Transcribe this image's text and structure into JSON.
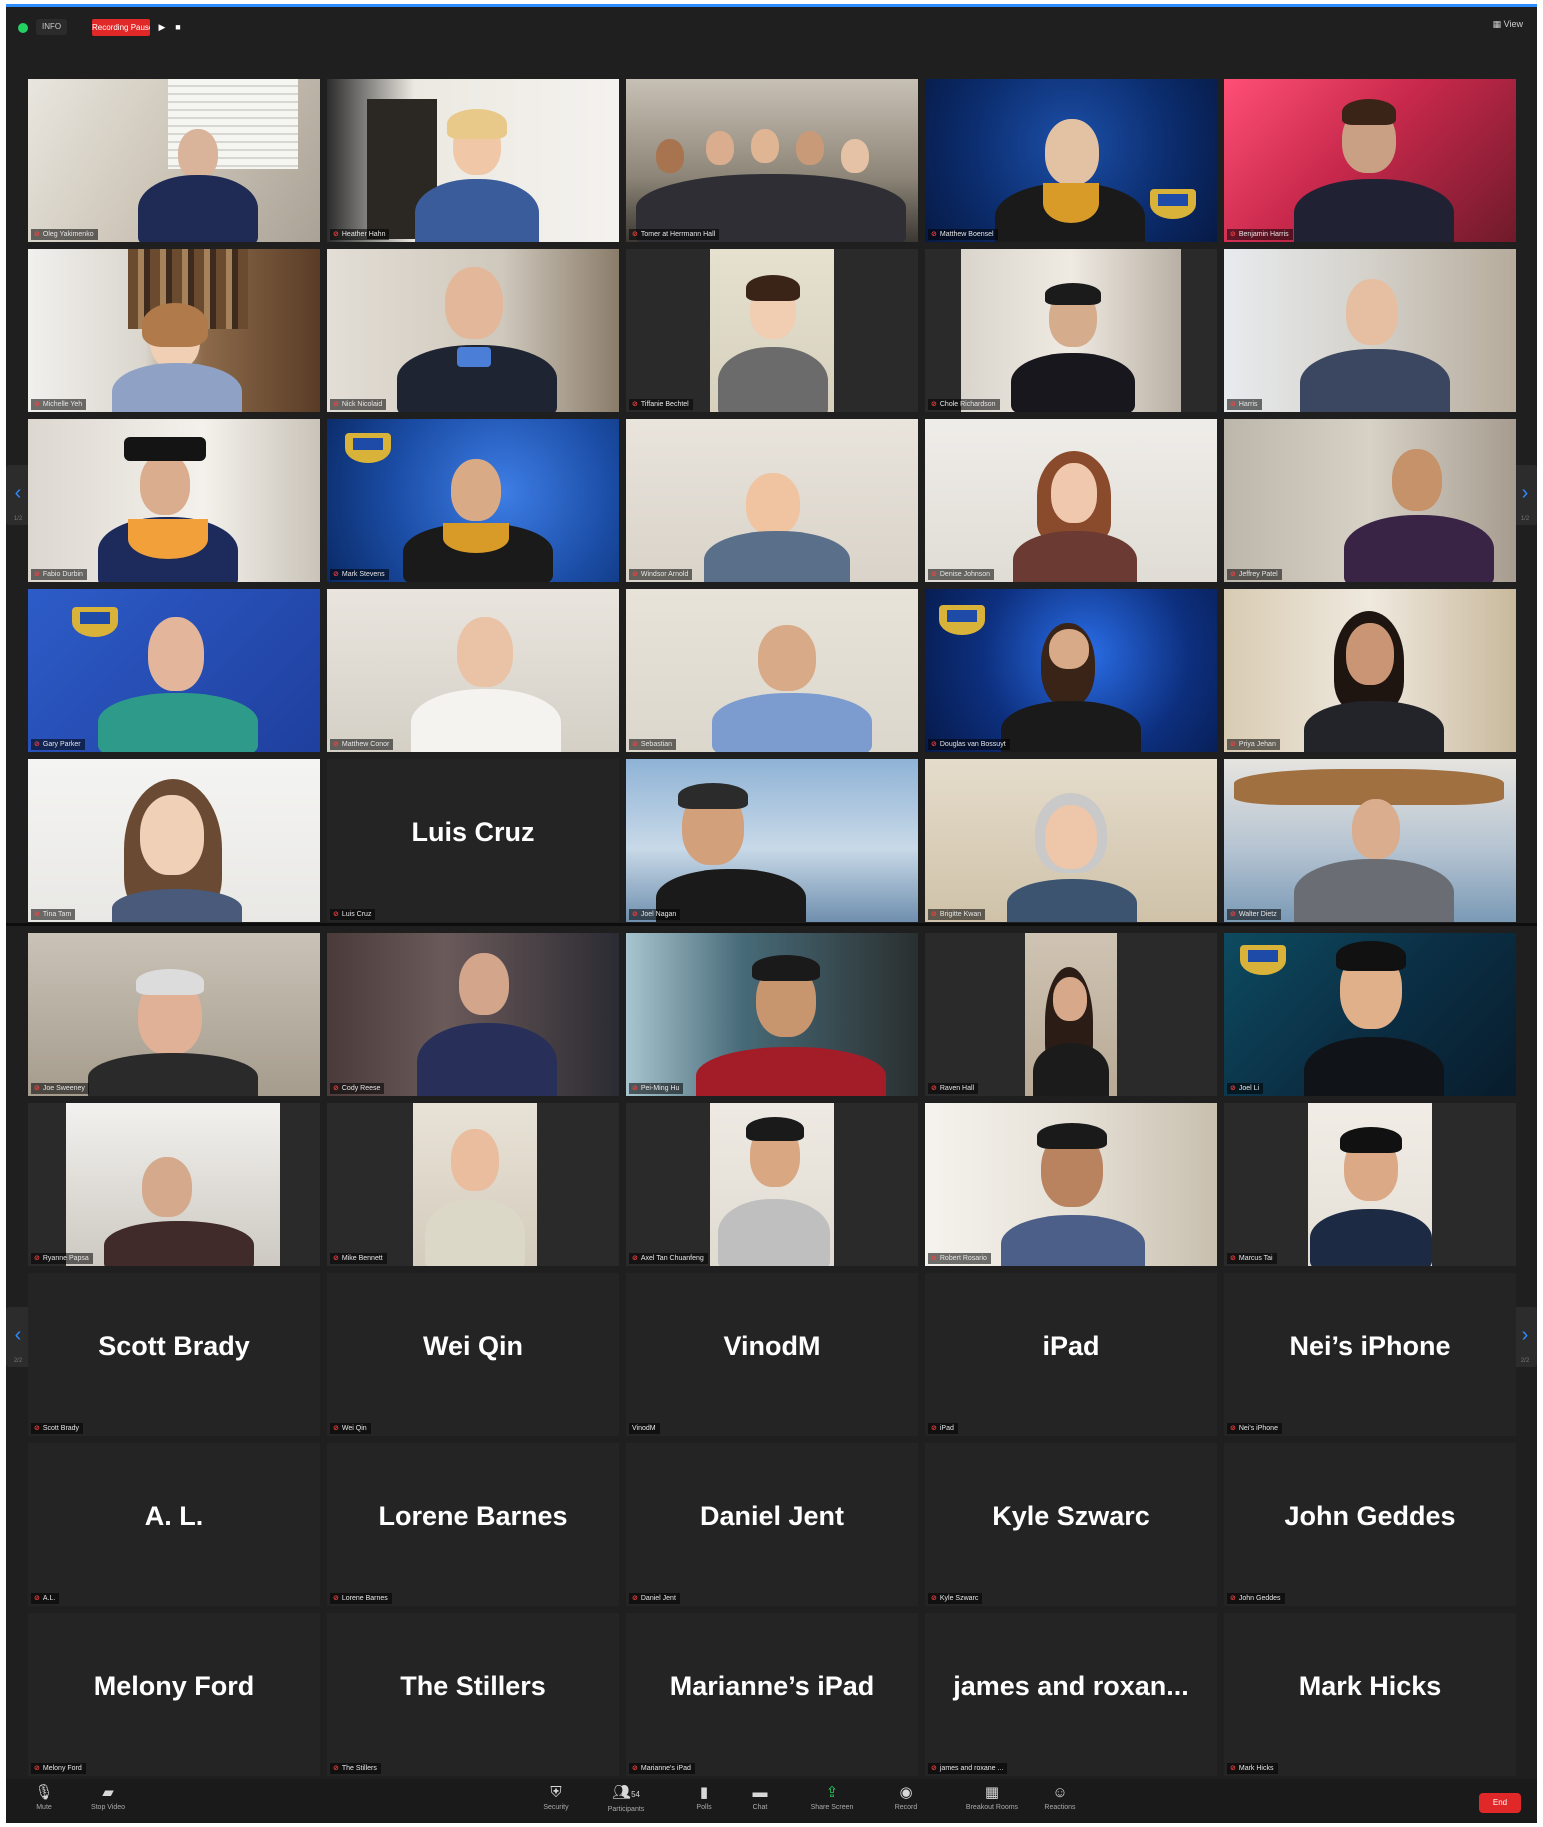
{
  "topbar": {
    "info_label": "INFO",
    "recording_status": "Recording Paused",
    "resume_icon": "play-icon",
    "stop_icon": "stop-icon",
    "view_label": "View"
  },
  "page1": {
    "tiles": [
      {
        "label": "Oleg Yakimenko",
        "center": ""
      },
      {
        "label": "Heather Hahn",
        "center": ""
      },
      {
        "label": "Tomer at Herrmann Hall",
        "center": ""
      },
      {
        "label": "Matthew Boensel",
        "center": ""
      },
      {
        "label": "Benjamin Harris",
        "center": ""
      },
      {
        "label": "Michelle Yeh",
        "center": ""
      },
      {
        "label": "Nick Nicolaid",
        "center": ""
      },
      {
        "label": "Tiffanie Bechtel",
        "center": ""
      },
      {
        "label": "Chole Richardson",
        "center": ""
      },
      {
        "label": "Harris",
        "center": ""
      },
      {
        "label": "Fabio Durbin",
        "center": ""
      },
      {
        "label": "Mark Stevens",
        "center": ""
      },
      {
        "label": "Windsor Arnold",
        "center": ""
      },
      {
        "label": "Denise Johnson",
        "center": ""
      },
      {
        "label": "Jeffrey Patel",
        "center": ""
      },
      {
        "label": "Gary Parker",
        "center": ""
      },
      {
        "label": "Matthew Conor",
        "center": ""
      },
      {
        "label": "Sebastian",
        "center": ""
      },
      {
        "label": "Douglas van Bossuyt",
        "center": ""
      },
      {
        "label": "Priya Jehan",
        "center": ""
      },
      {
        "label": "Tina Tam",
        "center": ""
      },
      {
        "label": "Luis Cruz",
        "center": "Luis Cruz"
      },
      {
        "label": "Joel Nagan",
        "center": ""
      },
      {
        "label": "Brigitte Kwan",
        "center": ""
      },
      {
        "label": "Walter Dietz",
        "center": ""
      }
    ]
  },
  "page2": {
    "tiles": [
      {
        "label": "Joe Sweeney",
        "center": ""
      },
      {
        "label": "Cody Reese",
        "center": ""
      },
      {
        "label": "Pei-Ming Hu",
        "center": ""
      },
      {
        "label": "Raven Hall",
        "center": ""
      },
      {
        "label": "Joel Li",
        "center": ""
      },
      {
        "label": "Ryanne Papsa",
        "center": ""
      },
      {
        "label": "Mike Bennett",
        "center": ""
      },
      {
        "label": "Axel Tan Chuanfeng",
        "center": ""
      },
      {
        "label": "Robert Rosario",
        "center": ""
      },
      {
        "label": "Marcus Tai",
        "center": ""
      },
      {
        "label": "Scott Brady",
        "center": "Scott Brady"
      },
      {
        "label": "Wei Qin",
        "center": "Wei Qin"
      },
      {
        "label": "VinodM",
        "center": "VinodM"
      },
      {
        "label": "iPad",
        "center": "iPad"
      },
      {
        "label": "Nei's iPhone",
        "center": "Nei’s iPhone"
      },
      {
        "label": "A.L.",
        "center": "A. L."
      },
      {
        "label": "Lorene Barnes",
        "center": "Lorene Barnes"
      },
      {
        "label": "Daniel Jent",
        "center": "Daniel Jent"
      },
      {
        "label": "Kyle Szwarc",
        "center": "Kyle Szwarc"
      },
      {
        "label": "John Geddes",
        "center": "John Geddes"
      },
      {
        "label": "Melony Ford",
        "center": "Melony Ford"
      },
      {
        "label": "The Stillers",
        "center": "The Stillers"
      },
      {
        "label": "Marianne's iPad",
        "center": "Marianne’s iPad"
      },
      {
        "label": "james and roxane ...",
        "center": "james  and  roxan..."
      },
      {
        "label": "Mark Hicks",
        "center": "Mark Hicks"
      }
    ]
  },
  "nav": {
    "page1_prev": "‹",
    "page1_prev_count": "1/2",
    "page1_next": "›",
    "page1_next_count": "1/2",
    "page2_prev": "‹",
    "page2_prev_count": "2/2",
    "page2_next": "›",
    "page2_next_count": "2/2"
  },
  "toolbar": {
    "mute_label": "Mute",
    "video_label": "Stop Video",
    "security_label": "Security",
    "participants_label": "Participants",
    "participants_count": "54",
    "polls_label": "Polls",
    "chat_label": "Chat",
    "share_label": "Share Screen",
    "record_label": "Record",
    "breakout_label": "Breakout Rooms",
    "reactions_label": "Reactions",
    "end_label": "End"
  },
  "colors": {
    "accent": "#2d8cff",
    "recording": "#e02828",
    "speaking_outline": "#c6e05a",
    "background": "#1f1f1f"
  }
}
